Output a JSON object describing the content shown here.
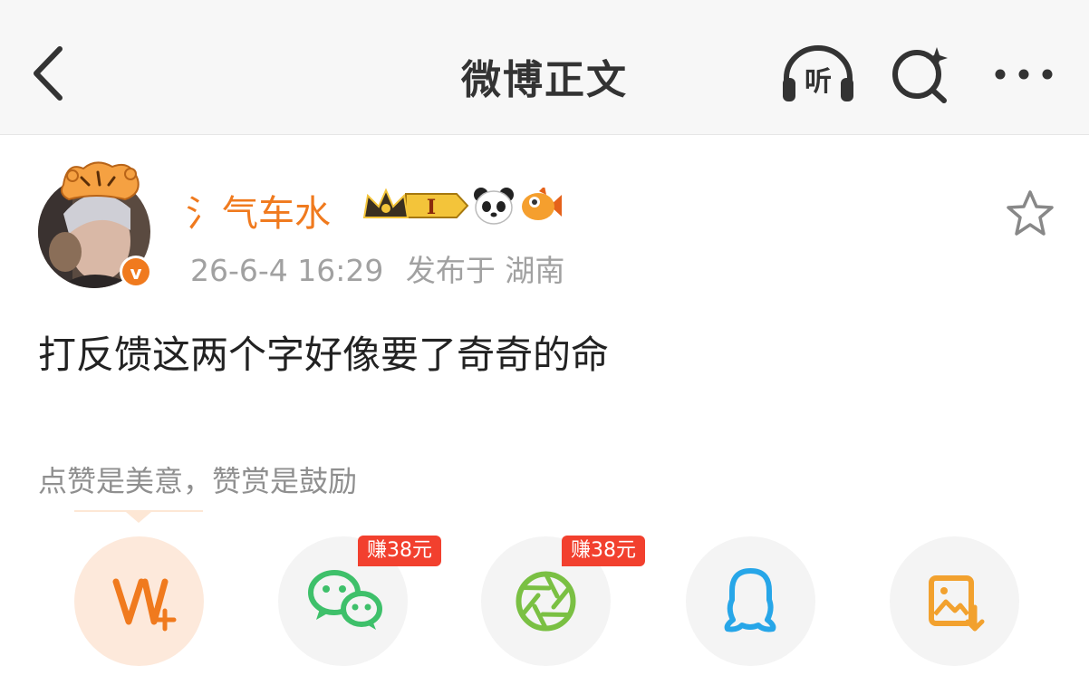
{
  "header": {
    "title": "微博正文",
    "listen_label": "听"
  },
  "post": {
    "username": "氵气车水",
    "vip_level": "I",
    "time": "26-6-4 16:29",
    "location": "发布于 湖南",
    "content": "打反馈这两个字好像要了奇奇的命"
  },
  "reward": {
    "hint": "点赞是美意，赞赏是鼓励"
  },
  "share": {
    "wechat_earn": "赚38元",
    "moments_earn": "赚38元"
  },
  "colors": {
    "accent": "#f07a1e",
    "wechat": "#3ec06a",
    "moments": "#7ac043",
    "qq": "#27a6e8",
    "save": "#f2a12e",
    "earn_tag": "#f2402e"
  }
}
